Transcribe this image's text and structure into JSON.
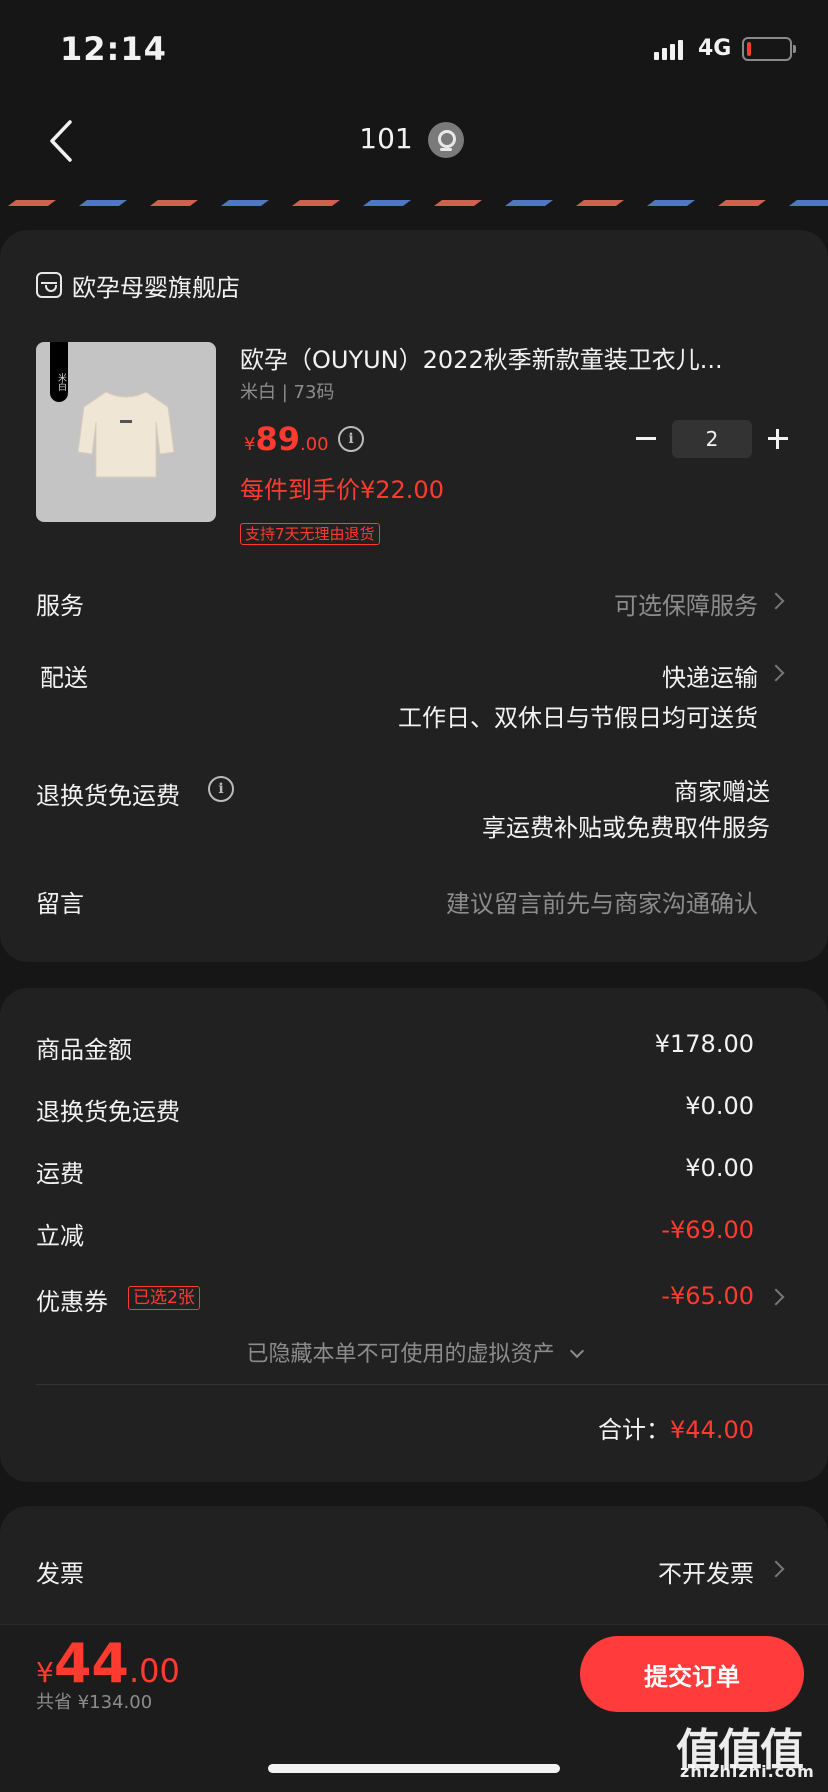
{
  "status_bar": {
    "time": "12:14",
    "network": "4G"
  },
  "nav": {
    "title": "101"
  },
  "store": {
    "name": "欧孕母婴旗舰店"
  },
  "product": {
    "title": "欧孕（OUYUN）2022秋季新款童装卫衣儿...",
    "spec": "米白 | 73码",
    "thumb_tag": "米白",
    "price_symbol": "¥",
    "price_int": "89",
    "price_dec": ".00",
    "unit_price": "每件到手价¥22.00",
    "return_tag": "支持7天无理由退货",
    "quantity": "2"
  },
  "rows": {
    "service": {
      "label": "服务",
      "value": "可选保障服务"
    },
    "delivery": {
      "label": "配送",
      "value": "快递运输",
      "sub": "工作日、双休日与节假日均可送货"
    },
    "free_return": {
      "label": "退换货免运费",
      "value": "商家赠送",
      "sub": "享运费补贴或免费取件服务"
    },
    "message": {
      "label": "留言",
      "placeholder": "建议留言前先与商家沟通确认"
    }
  },
  "summary": {
    "goods": {
      "label": "商品金额",
      "value": "¥178.00"
    },
    "return_fee": {
      "label": "退换货免运费",
      "value": "¥0.00"
    },
    "shipping": {
      "label": "运费",
      "value": "¥0.00"
    },
    "discount": {
      "label": "立减",
      "value": "-¥69.00"
    },
    "coupon": {
      "label": "优惠券",
      "tag": "已选2张",
      "value": "-¥65.00"
    },
    "hidden_assets": "已隐藏本单不可使用的虚拟资产",
    "total_label": "合计：",
    "total_value": "¥44.00"
  },
  "invoice": {
    "label": "发票",
    "value": "不开发票"
  },
  "bottom": {
    "symbol": "¥",
    "total_int": "44",
    "total_dec": ".00",
    "saved": "共省 ¥134.00",
    "submit": "提交订单"
  },
  "watermark": {
    "main": "值值值",
    "sub": "zhizhizhi.com"
  },
  "colors": {
    "accent": "#ff3b30",
    "background": "#161616",
    "card": "#212121"
  }
}
